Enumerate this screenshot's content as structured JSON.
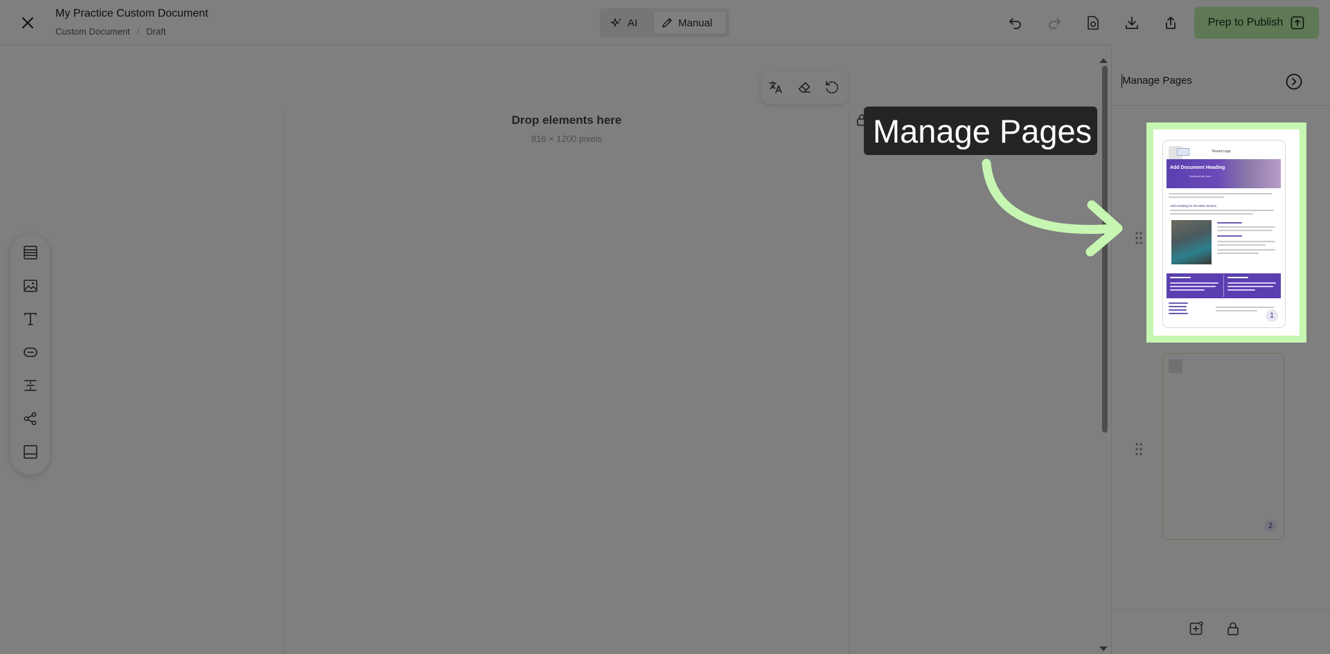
{
  "header": {
    "title": "My Practice Custom Document",
    "breadcrumb": [
      "Custom Document",
      "Draft"
    ],
    "mode_toggle": {
      "ai_label": "AI",
      "manual_label": "Manual",
      "active": "Manual"
    },
    "publish_label": "Prep to Publish"
  },
  "canvas": {
    "drop_title": "Drop elements here",
    "drop_subtitle": "816 × 1200 pixels"
  },
  "panel": {
    "title": "Manage Pages",
    "pages": [
      {
        "number": "1",
        "logo_text": "Tenant Logo",
        "heading": "Add Document Heading",
        "subheading": "Optional text here",
        "section_title": "Add Heading for the Main Section"
      },
      {
        "number": "2"
      }
    ]
  },
  "callout": {
    "text": "Manage Pages"
  },
  "colors": {
    "accent_green": "#bdf3a9",
    "highlight_green": "#c7f6b3",
    "thumb_purple": "#5b3fb0",
    "overlay": "rgba(0,0,0,0.5)"
  }
}
